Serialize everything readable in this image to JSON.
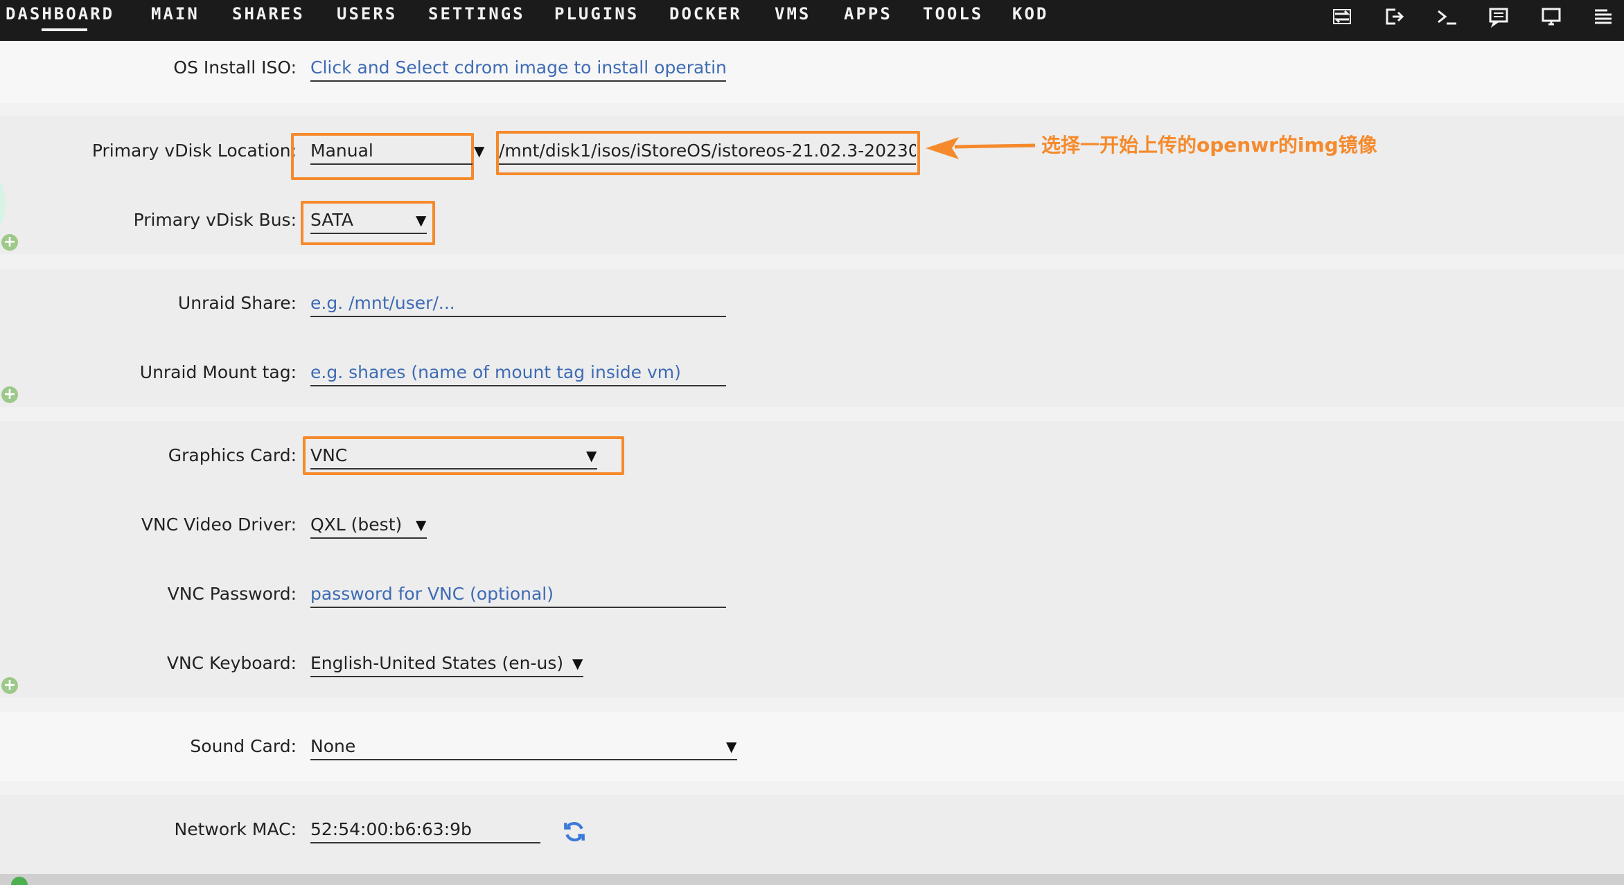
{
  "nav": {
    "tabs": [
      "DASHBOARD",
      "MAIN",
      "SHARES",
      "USERS",
      "SETTINGS",
      "PLUGINS",
      "DOCKER",
      "VMS",
      "APPS",
      "TOOLS",
      "KOD"
    ],
    "active_tab": "DASHBOARD",
    "icons": [
      "switch-icon",
      "logout-icon",
      "terminal-icon",
      "feedback-icon",
      "info-icon",
      "log-icon"
    ]
  },
  "form": {
    "os_install_iso": {
      "label": "OS Install ISO:",
      "placeholder": "Click and Select cdrom image to install operating sy"
    },
    "primary_vdisk_location": {
      "label": "Primary vDisk Location:",
      "value": "Manual",
      "path": "/mnt/disk1/isos/iStoreOS/istoreos-21.02.3-20230"
    },
    "primary_vdisk_bus": {
      "label": "Primary vDisk Bus:",
      "value": "SATA"
    },
    "unraid_share": {
      "label": "Unraid Share:",
      "placeholder": "e.g. /mnt/user/..."
    },
    "unraid_mount_tag": {
      "label": "Unraid Mount tag:",
      "placeholder": "e.g. shares (name of mount tag inside vm)"
    },
    "graphics_card": {
      "label": "Graphics Card:",
      "value": "VNC"
    },
    "vnc_video_driver": {
      "label": "VNC Video Driver:",
      "value": "QXL (best)"
    },
    "vnc_password": {
      "label": "VNC Password:",
      "placeholder": "password for VNC (optional)"
    },
    "vnc_keyboard": {
      "label": "VNC Keyboard:",
      "value": "English-United States (en-us)"
    },
    "sound_card": {
      "label": "Sound Card:",
      "value": "None"
    },
    "network_mac": {
      "label": "Network MAC:",
      "value": "52:54:00:b6:63:9b"
    }
  },
  "annotation": {
    "text": "选择一开始上传的openwr的img镜像"
  },
  "colors": {
    "accent": "#f58a2c",
    "placeholder": "#3e6bb4",
    "nav_bg": "#1c1b1b",
    "add_icon": "#9dc98a"
  },
  "caret_glyph": "▼",
  "plus_glyph": "+"
}
